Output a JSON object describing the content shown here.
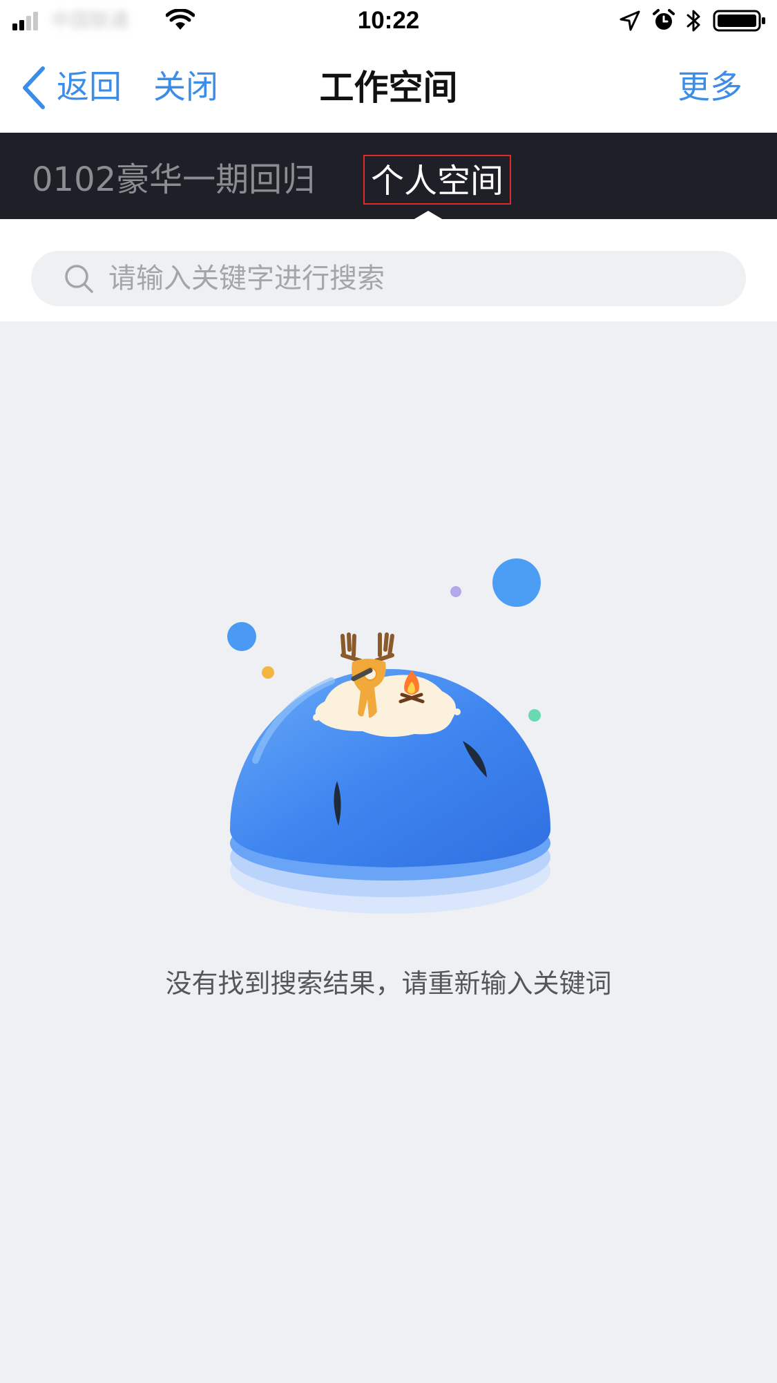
{
  "status_bar": {
    "carrier": "中国联通",
    "time": "10:22",
    "icons": [
      "signal-icon",
      "wifi-icon",
      "location-icon",
      "alarm-icon",
      "bluetooth-icon",
      "battery-icon"
    ]
  },
  "nav": {
    "back_label": "返回",
    "close_label": "关闭",
    "title": "工作空间",
    "more_label": "更多",
    "accent_color": "#3b8de8"
  },
  "tabs": {
    "items": [
      {
        "label": "0102豪华一期回归",
        "active": false
      },
      {
        "label": "个人空间",
        "active": true
      }
    ],
    "bar_color": "#1f2027"
  },
  "search": {
    "placeholder": "请输入关键字进行搜索",
    "value": ""
  },
  "empty_state": {
    "illustration": "empty-globe-deer-illustration",
    "message": "没有找到搜索结果，请重新输入关键词"
  }
}
